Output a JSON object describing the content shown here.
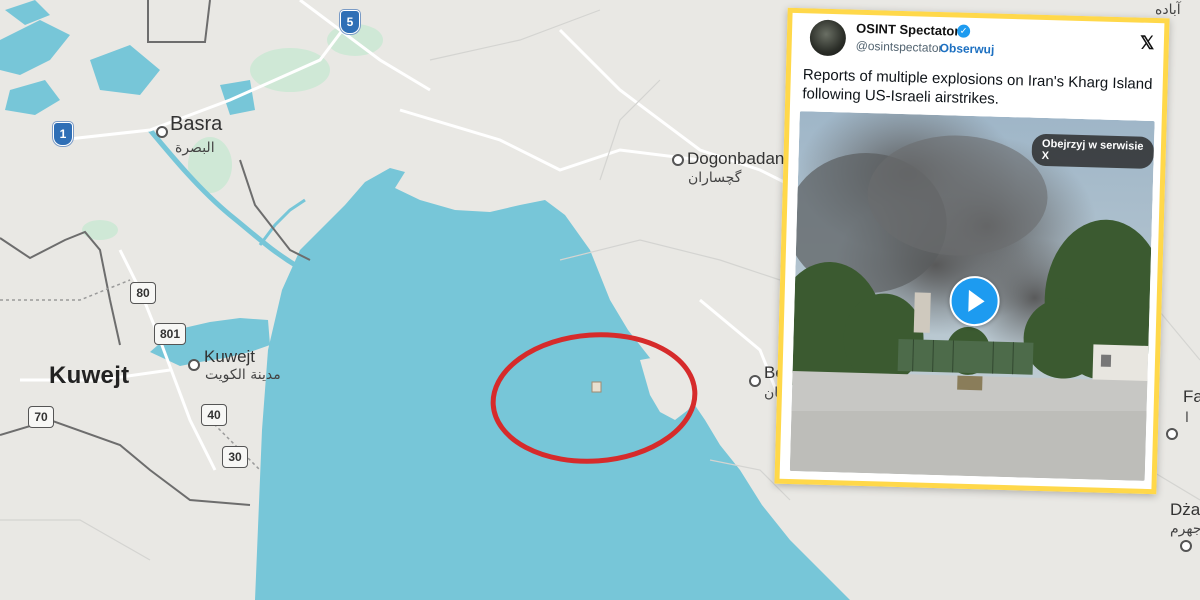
{
  "map": {
    "country_label": "Kuwejt",
    "cities": [
      {
        "name": "Basra",
        "arabic": "البصرة"
      },
      {
        "name": "Kuwejt",
        "arabic": "مدينة الكويت"
      },
      {
        "name": "Dogonbadan",
        "arabic": "گچساران"
      },
      {
        "name": "Bo",
        "arabic": "جان"
      },
      {
        "name": "Fa",
        "arabic": "ا"
      },
      {
        "name": "Dża",
        "arabic": "جهرم"
      }
    ],
    "roads": [
      "80",
      "801",
      "40",
      "30",
      "70"
    ],
    "highways": [
      "1",
      "5"
    ],
    "top_arabic": "آباده",
    "sea_color": "#77c6d8",
    "land_color": "#e9e8e4",
    "highlight_color": "#d62b2b"
  },
  "tweet": {
    "username": "OSINT Spectator",
    "verified_mark": "✓",
    "handle": "@osintspectator",
    "separator": "·",
    "follow_label": "Obserwuj",
    "x_logo": "𝕏",
    "text": "Reports of multiple explosions on Iran's Kharg Island following US-Israeli airstrikes.",
    "watch_label": "Obejrzyj w serwisie X",
    "frame_color": "#ffd84a"
  }
}
